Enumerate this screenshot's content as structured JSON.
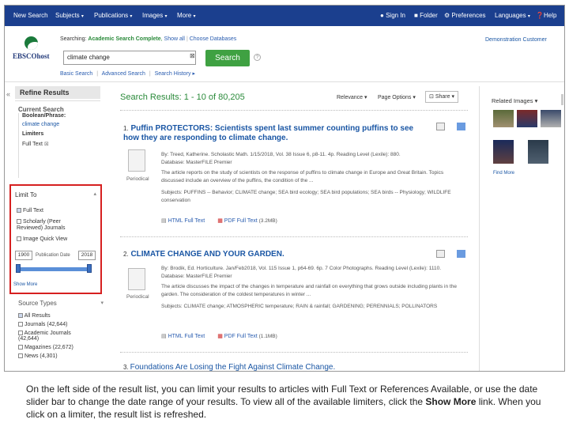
{
  "topnav": {
    "left": [
      "New Search",
      "Subjects",
      "Publications",
      "Images",
      "More"
    ],
    "right": [
      "Sign In",
      "Folder",
      "Preferences",
      "Languages",
      "Help"
    ]
  },
  "search": {
    "logo": "EBSCOhost",
    "searching_prefix": "Searching:",
    "database": "Academic Search Complete",
    "show_all": "Show all",
    "choose_db": "Choose Databases",
    "query": "climate change",
    "button": "Search",
    "help": "?",
    "links": [
      "Basic Search",
      "Advanced Search",
      "Search History ▸"
    ],
    "customer": "Demonstration Customer"
  },
  "left": {
    "collapse": "«",
    "refine": "Refine Results",
    "current_search": "Current Search",
    "boolean_label": "Boolean/Phrase:",
    "boolean_value": "climate change",
    "limiters": "Limiters",
    "full_text_tag": "Full Text",
    "limit_to": "Limit To",
    "limit_options": [
      "Full Text",
      "Scholarly (Peer Reviewed) Journals",
      "Image Quick View"
    ],
    "date_from": "1900",
    "date_label": "Publication Date",
    "date_to": "2018",
    "show_more": "Show More",
    "source_types": "Source Types",
    "sources": [
      "All Results",
      "Journals (42,644)",
      "Academic Journals (42,644)",
      "Magazines (22,672)",
      "News (4,301)"
    ]
  },
  "main": {
    "results_heading": "Search Results: 1 - 10 of 80,205",
    "relevance": "Relevance",
    "page_options": "Page Options",
    "share": "Share",
    "results": [
      {
        "num": "1.",
        "title": "Puffin PROTECTORS: Scientists spent last summer counting puffins to see how they are responding to climate change.",
        "meta": "By: Treed, Katherine. Scholastic Math. 1/15/2018, Vol. 38 Issue 6, p8-11. 4p. Reading Level (Lexile): 880.",
        "db": "Database: MasterFILE Premier",
        "abstract": "The article reports on the study of scientists on the response of puffins to climate change in Europe and Great Britain. Topics discussed include an overview of the puffins, the condition of the ...",
        "subjects": "Subjects: PUFFINS -- Behavior; CLIMATE change; SEA bird ecology; SEA bird populations; SEA birds -- Physiology; WILDLIFE conservation",
        "type": "Periodical",
        "html": "HTML Full Text",
        "pdf": "PDF Full Text",
        "pdf_size": "(3.2MB)"
      },
      {
        "num": "2.",
        "title": "CLIMATE CHANGE AND YOUR GARDEN.",
        "meta": "By: Brodik, Ed. Horticulture. Jan/Feb2018, Vol. 115 Issue 1, p64-69. 6p. 7 Color Photographs. Reading Level (Lexile): 1110.",
        "db": "Database: MasterFILE Premier",
        "abstract": "The article discusses the impact of the changes in temperature and rainfall on everything that grows outside including plants in the garden. The consideration of the coldest temperatures in winter ...",
        "subjects": "Subjects: CLIMATE change; ATMOSPHERIC temperature; RAIN & rainfall; GARDENING; PERENNIALS; POLLINATORS",
        "type": "Periodical",
        "html": "HTML Full Text",
        "pdf": "PDF Full Text",
        "pdf_size": "(1.1MB)"
      }
    ],
    "third_num": "3.",
    "third_title": "Foundations Are Losing the Fight Against Climate Change."
  },
  "right": {
    "related": "Related Images",
    "find_more": "Find More"
  },
  "caption": {
    "part1": "On the left side of the result list, you can limit your results to articles with Full Text or References Available, or use the date slider bar to change the date range of your results. To view all of the available limiters, click the ",
    "bold": "Show More",
    "part2": " link. When you click on a limiter, the result list is refreshed."
  },
  "colors": {
    "navbar": "#1b3f8e",
    "search_button": "#3fa142",
    "link": "#1a56a4",
    "highlight_box": "#d62020"
  }
}
